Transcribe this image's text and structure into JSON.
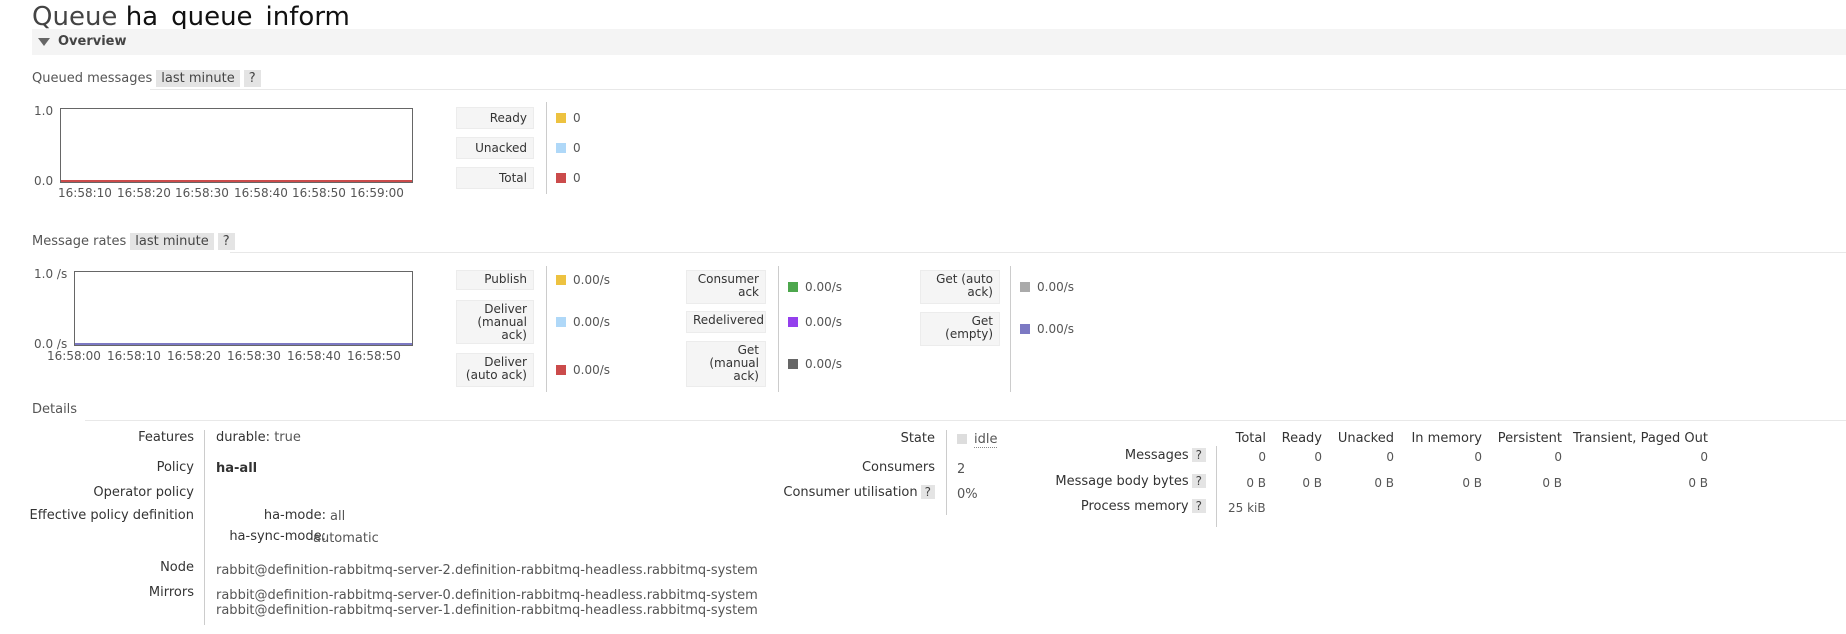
{
  "header": {
    "title_prefix": "Queue",
    "queue_name": "ha_queue_inform"
  },
  "overview": {
    "label": "Overview"
  },
  "queued_messages": {
    "title": "Queued messages",
    "range": "last minute",
    "help": "?",
    "ymax_label": "1.0",
    "ymin_label": "0.0",
    "x_ticks": [
      "16:58:10",
      "16:58:20",
      "16:58:30",
      "16:58:40",
      "16:58:50",
      "16:59:00"
    ],
    "legend": [
      {
        "label": "Ready",
        "value": "0",
        "color": "#edc240"
      },
      {
        "label": "Unacked",
        "value": "0",
        "color": "#afd8f8"
      },
      {
        "label": "Total",
        "value": "0",
        "color": "#cb4b4b"
      }
    ]
  },
  "message_rates": {
    "title": "Message rates",
    "range": "last minute",
    "help": "?",
    "ymax_label": "1.0 /s",
    "ymin_label": "0.0 /s",
    "x_ticks": [
      "16:58:00",
      "16:58:10",
      "16:58:20",
      "16:58:30",
      "16:58:40",
      "16:58:50"
    ],
    "col1": [
      {
        "label": "Publish",
        "value": "0.00/s",
        "color": "#edc240"
      },
      {
        "label": "Deliver (manual ack)",
        "value": "0.00/s",
        "color": "#afd8f8"
      },
      {
        "label": "Deliver (auto ack)",
        "value": "0.00/s",
        "color": "#cb4b4b"
      }
    ],
    "col2": [
      {
        "label": "Consumer ack",
        "value": "0.00/s",
        "color": "#4da74d"
      },
      {
        "label": "Redelivered",
        "value": "0.00/s",
        "color": "#9440ed"
      },
      {
        "label": "Get (manual ack)",
        "value": "0.00/s",
        "color": "#666666"
      }
    ],
    "col3": [
      {
        "label": "Get (auto ack)",
        "value": "0.00/s",
        "color": "#aaaaaa"
      },
      {
        "label": "Get (empty)",
        "value": "0.00/s",
        "color": "#7c79c3"
      }
    ]
  },
  "details": {
    "title": "Details",
    "features_label": "Features",
    "durable_key": "durable:",
    "durable_value": "true",
    "policy_label": "Policy",
    "policy_value": "ha-all",
    "operator_policy_label": "Operator policy",
    "effective_label": "Effective policy definition",
    "ha_mode_key": "ha-mode:",
    "ha_mode_value": "all",
    "ha_sync_key": "ha-sync-mode:",
    "ha_sync_value": "automatic",
    "node_label": "Node",
    "node_value": "rabbit@definition-rabbitmq-server-2.definition-rabbitmq-headless.rabbitmq-system",
    "mirrors_label": "Mirrors",
    "mirrors": [
      "rabbit@definition-rabbitmq-server-0.definition-rabbitmq-headless.rabbitmq-system",
      "rabbit@definition-rabbitmq-server-1.definition-rabbitmq-headless.rabbitmq-system"
    ],
    "state_label": "State",
    "state_value": "idle",
    "consumers_label": "Consumers",
    "consumers_value": "2",
    "utilisation_label": "Consumer utilisation",
    "utilisation_help": "?",
    "utilisation_value": "0%"
  },
  "stats_table": {
    "columns": [
      "Total",
      "Ready",
      "Unacked",
      "In memory",
      "Persistent",
      "Transient, Paged Out"
    ],
    "rows": [
      {
        "label": "Messages",
        "help": "?",
        "values": [
          "0",
          "0",
          "0",
          "0",
          "0",
          "0"
        ]
      },
      {
        "label": "Message body bytes",
        "help": "?",
        "values": [
          "0 B",
          "0 B",
          "0 B",
          "0 B",
          "0 B",
          "0 B"
        ]
      },
      {
        "label": "Process memory",
        "help": "?",
        "values": [
          "25 kiB"
        ]
      }
    ]
  }
}
